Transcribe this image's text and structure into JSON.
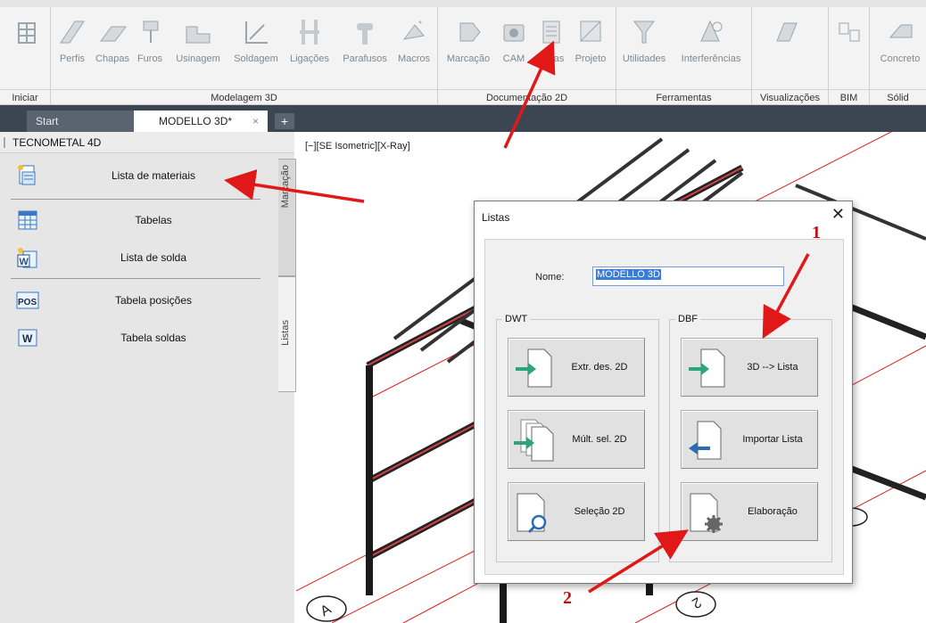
{
  "ribbon": {
    "buttons": [
      {
        "label": "",
        "icon": "grid-icon"
      },
      {
        "label": "Perfis",
        "icon": "profile-beam-icon"
      },
      {
        "label": "Chapas",
        "icon": "plate-icon"
      },
      {
        "label": "Furos",
        "icon": "drill-icon"
      },
      {
        "label": "Usinagem",
        "icon": "machining-icon"
      },
      {
        "label": "Soldagem",
        "icon": "weld-icon"
      },
      {
        "label": "Ligações",
        "icon": "connection-icon"
      },
      {
        "label": "Parafusos",
        "icon": "bolt-icon"
      },
      {
        "label": "Macros",
        "icon": "macro-icon"
      },
      {
        "label": "Marcação",
        "icon": "tag-icon"
      },
      {
        "label": "CAM",
        "icon": "cam-icon"
      },
      {
        "label": "Listas",
        "icon": "list-icon"
      },
      {
        "label": "Projeto",
        "icon": "project-icon"
      },
      {
        "label": "Utilidades",
        "icon": "funnel-icon"
      },
      {
        "label": "Interferências",
        "icon": "interference-icon"
      },
      {
        "label": "",
        "icon": "view-icon"
      },
      {
        "label": "",
        "icon": "bim-icon"
      },
      {
        "label": "Concreto",
        "icon": "concrete-icon"
      }
    ],
    "panels": [
      "Iniciar",
      "Modelagem 3D",
      "Documentação 2D",
      "Ferramentas",
      "Visualizações",
      "BIM",
      "Sólid"
    ]
  },
  "tabs": {
    "start": "Start",
    "model": "MODELLO 3D*",
    "close": "×",
    "add": "+"
  },
  "palette": {
    "title": "TECNOMETAL 4D",
    "items": [
      {
        "label": "Lista de materiais",
        "icon": "material-list-icon"
      },
      {
        "label": "Tabelas",
        "icon": "table-icon"
      },
      {
        "label": "Lista de solda",
        "icon": "weld-list-icon"
      },
      {
        "label": "Tabela posições",
        "icon": "pos-icon",
        "badge": "POS"
      },
      {
        "label": "Tabela soldas",
        "icon": "weld-table-icon",
        "badge": "W"
      }
    ],
    "side_tabs": [
      "Marcação",
      "Listas"
    ]
  },
  "viewport": {
    "label": "[−][SE Isometric][X-Ray]",
    "grid_labels": [
      "A",
      "2"
    ]
  },
  "dialog": {
    "title": "Listas",
    "close": "✕",
    "name_label": "Nome:",
    "name_value": "MODELLO 3D",
    "groups": [
      {
        "label": "DWT",
        "buttons": [
          "Extr. des. 2D",
          "Múlt. sel. 2D",
          "Seleção 2D"
        ]
      },
      {
        "label": "DBF",
        "buttons": [
          "3D --> Lista",
          "Importar Lista",
          "Elaboração"
        ]
      }
    ]
  },
  "annotations": {
    "step1": "1",
    "step2": "2",
    "color": "#e01818"
  },
  "colors": {
    "tabstrip": "#3c4653",
    "arrow_green": "#2fa37a",
    "arrow_blue": "#2a6db5",
    "selection": "#3a7bd5"
  }
}
